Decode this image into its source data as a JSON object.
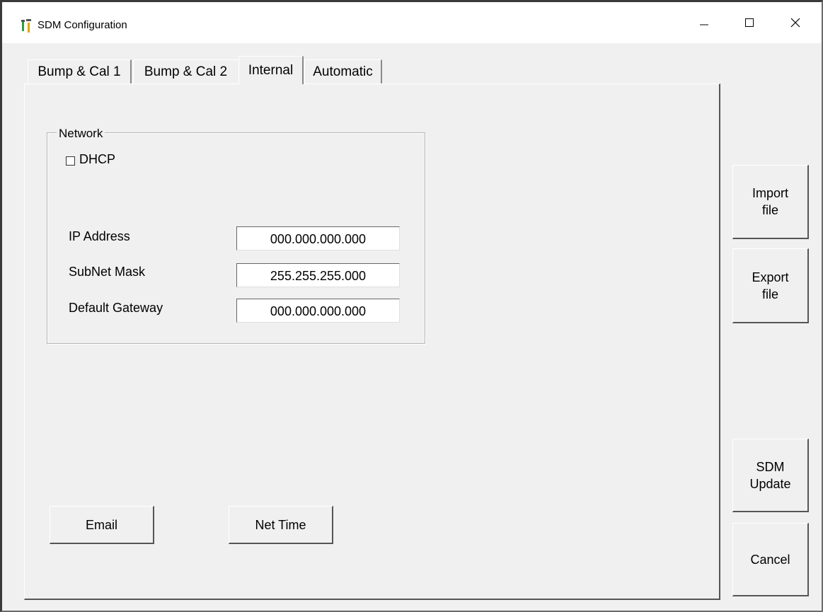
{
  "window": {
    "title": "SDM Configuration",
    "icon": "tools-icon",
    "controls": {
      "minimize": "minimize-icon",
      "maximize": "maximize-icon",
      "close": "close-icon"
    }
  },
  "tabs": [
    {
      "label": "Bump & Cal 1",
      "active": false
    },
    {
      "label": "Bump & Cal 2",
      "active": false
    },
    {
      "label": "Internal",
      "active": true
    },
    {
      "label": "Automatic",
      "active": false
    }
  ],
  "network": {
    "group_label": "Network",
    "dhcp": {
      "label": "DHCP",
      "checked": false
    },
    "fields": [
      {
        "label": "IP Address",
        "value": "000.000.000.000"
      },
      {
        "label": "SubNet Mask",
        "value": "255.255.255.000"
      },
      {
        "label": "Default Gateway",
        "value": "000.000.000.000"
      }
    ]
  },
  "bottom_buttons": {
    "email": "Email",
    "net_time": "Net Time"
  },
  "side_buttons": {
    "import": "Import file",
    "export": "Export file",
    "sdm_update": "SDM Update",
    "cancel": "Cancel"
  }
}
